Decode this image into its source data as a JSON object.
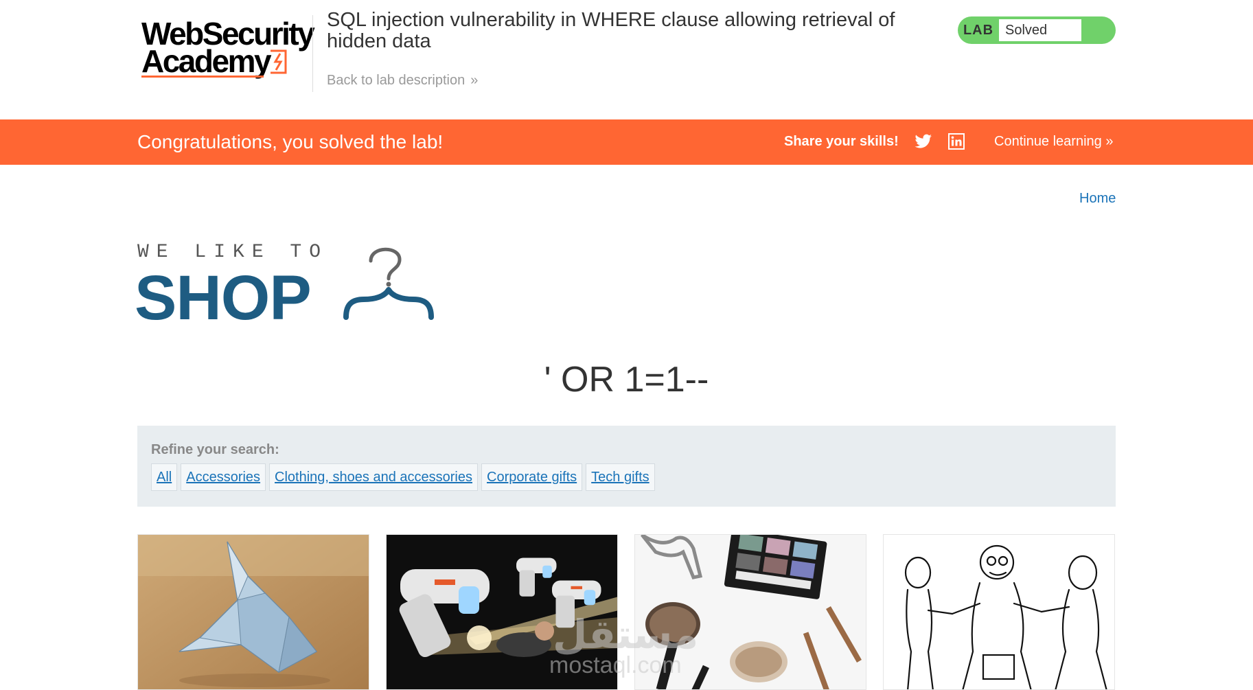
{
  "header": {
    "logo_line1": "WebSecurity",
    "logo_line2": "Academy",
    "lab_title": "SQL injection vulnerability in WHERE clause allowing retrieval of hidden data",
    "back_link": "Back to lab description",
    "status_tag": "LAB",
    "status_text": "Solved"
  },
  "banner": {
    "message": "Congratulations, you solved the lab!",
    "share": "Share your skills!",
    "continue": "Continue learning"
  },
  "nav": {
    "home": "Home"
  },
  "shop_logo": {
    "tagline": "WE LIKE TO",
    "title": "SHOP"
  },
  "search": {
    "term": "' OR 1=1--"
  },
  "filters": {
    "label": "Refine your search:",
    "categories": [
      "All",
      "Accessories",
      "Clothing, shoes and accessories",
      "Corporate gifts",
      "Tech gifts"
    ]
  },
  "watermark": {
    "arabic": "مستقل",
    "latin": "mostaql.com"
  },
  "colors": {
    "banner": "#ff6633",
    "status_green": "#70d16a",
    "link_blue": "#1a73b8",
    "shop_blue": "#1e5c82"
  }
}
